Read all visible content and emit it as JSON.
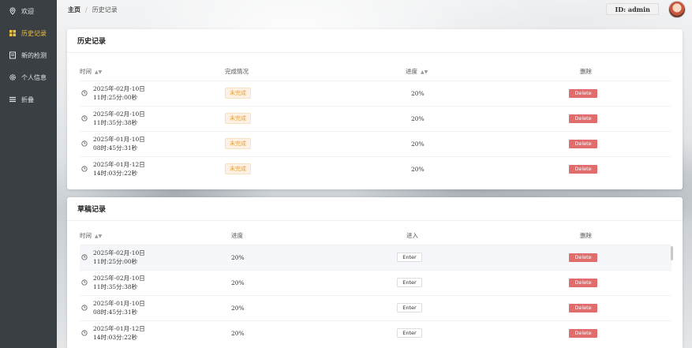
{
  "sidebar": {
    "items": [
      {
        "label": "欢迎",
        "icon": "location-pin-icon",
        "active": false
      },
      {
        "label": "历史记录",
        "icon": "grid-icon",
        "active": true
      },
      {
        "label": "新的检测",
        "icon": "document-icon",
        "active": false
      },
      {
        "label": "个人信息",
        "icon": "gear-icon",
        "active": false
      },
      {
        "label": "折叠",
        "icon": "menu-icon",
        "active": false
      }
    ]
  },
  "header": {
    "breadcrumb_home": "主页",
    "breadcrumb_sep": "/",
    "breadcrumb_current": "历史记录",
    "user_id": "ID: admin"
  },
  "history": {
    "title": "历史记录",
    "columns": [
      "时间",
      "完成情况",
      "进度",
      "删除"
    ],
    "rows": [
      {
        "date": "2025年-02月-10日",
        "time": "11时:25分:00秒",
        "status": "未完成",
        "progress": "20%",
        "delete": "Delete"
      },
      {
        "date": "2025年-02月-10日",
        "time": "11时:35分:38秒",
        "status": "未完成",
        "progress": "20%",
        "delete": "Delete"
      },
      {
        "date": "2025年-01月-10日",
        "time": "08时:45分:31秒",
        "status": "未完成",
        "progress": "20%",
        "delete": "Delete"
      },
      {
        "date": "2025年-01月-12日",
        "time": "14时:03分:22秒",
        "status": "未完成",
        "progress": "20%",
        "delete": "Delete"
      }
    ]
  },
  "drafts": {
    "title": "草稿记录",
    "columns": [
      "时间",
      "进度",
      "进入",
      "删除"
    ],
    "rows": [
      {
        "date": "2025年-02月-10日",
        "time": "11时:25分:00秒",
        "progress": "20%",
        "enter": "Enter",
        "delete": "Delete"
      },
      {
        "date": "2025年-02月-10日",
        "time": "11时:35分:38秒",
        "progress": "20%",
        "enter": "Enter",
        "delete": "Delete"
      },
      {
        "date": "2025年-01月-10日",
        "time": "08时:45分:31秒",
        "progress": "20%",
        "enter": "Enter",
        "delete": "Delete"
      },
      {
        "date": "2025年-01月-12日",
        "time": "14时:03分:22秒",
        "progress": "20%",
        "enter": "Enter",
        "delete": "Delete"
      }
    ]
  },
  "colors": {
    "sidebar_bg": "#3a3f44",
    "active_accent": "#f0c23b",
    "delete_btn": "#e06c6c",
    "tag_text": "#e6a23c"
  }
}
